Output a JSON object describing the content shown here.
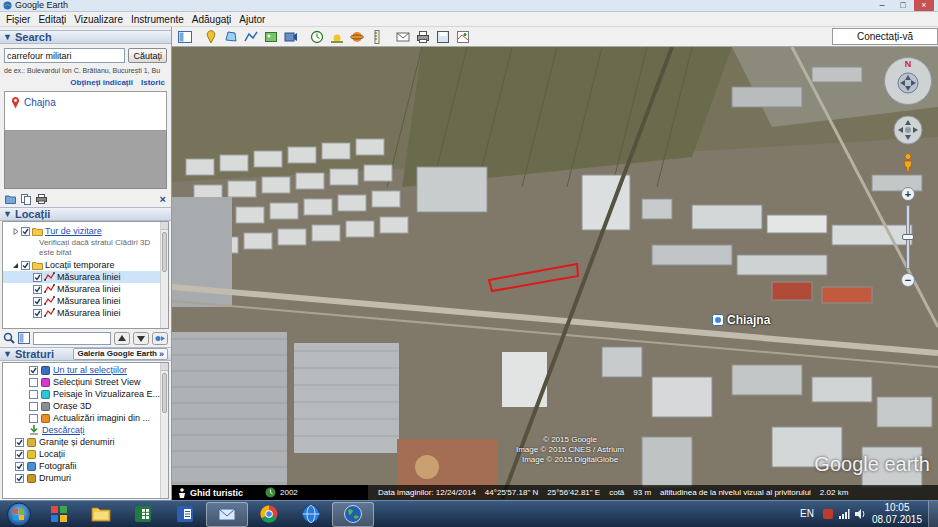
{
  "window": {
    "title": "Google Earth",
    "controls": [
      "–",
      "□",
      "×"
    ]
  },
  "menu": [
    "Fișier",
    "Editați",
    "Vizualizare",
    "Instrumente",
    "Adăugați",
    "Ajutor"
  ],
  "search": {
    "arrow": "▼",
    "header": "Search",
    "query": "carrefour militari",
    "button": "Căutați",
    "hint": "de ex.: Bulevardul Ion C. Brătianu, București 1, Bu",
    "links": [
      "Obțineți indicații",
      "Istoric"
    ],
    "results": [
      {
        "label": "Chajna",
        "selected": false
      }
    ]
  },
  "places": {
    "arrow": "▼",
    "header": "Locații",
    "close": "×",
    "items": [
      {
        "label": "Tur de vizitare",
        "kind": "folder",
        "checked": true,
        "expanded": false,
        "link": true,
        "selected": false,
        "note": "Verificați dacă stratul Clădiri 3D este bifat"
      },
      {
        "label": "Locații temporare",
        "kind": "folder",
        "checked": true,
        "expanded": true,
        "link": false,
        "selected": false,
        "children": [
          {
            "label": "Măsurarea liniei",
            "kind": "path",
            "checked": true,
            "link": false,
            "selected": true
          },
          {
            "label": "Măsurarea liniei",
            "kind": "path",
            "checked": true,
            "link": false,
            "selected": false
          },
          {
            "label": "Măsurarea liniei",
            "kind": "path",
            "checked": true,
            "link": false,
            "selected": false
          },
          {
            "label": "Măsurarea liniei",
            "kind": "path",
            "checked": true,
            "link": false,
            "selected": false
          }
        ]
      }
    ]
  },
  "layers": {
    "arrow": "▼",
    "header": "Straturi",
    "gallery": "Galeria Google Earth",
    "gallery_arrow": "»",
    "items": [
      {
        "label": "Un tur al selecțiilor",
        "kind": "sublayer",
        "checked": true,
        "link": true,
        "color": "#3a6fc4"
      },
      {
        "label": "Selecțiuni Street View",
        "kind": "sublayer",
        "checked": false,
        "link": false,
        "color": "#d23ad0"
      },
      {
        "label": "Peisaje în Vizualizarea E...",
        "kind": "sublayer",
        "checked": false,
        "link": false,
        "color": "#29c6d8"
      },
      {
        "label": "Orașe 3D",
        "kind": "sublayer",
        "checked": false,
        "link": false,
        "color": "#8a8f96"
      },
      {
        "label": "Actualizări imagini din ...",
        "kind": "sublayer",
        "checked": false,
        "link": false,
        "color": "#f08a24"
      },
      {
        "label": "Descărcați",
        "kind": "download",
        "checked": false,
        "link": true,
        "color": "#3b8c3b"
      },
      {
        "label": "Granițe și denumiri",
        "kind": "layer",
        "checked": true,
        "link": false,
        "color": "#d9b23a"
      },
      {
        "label": "Locații",
        "kind": "layer",
        "checked": true,
        "link": false,
        "color": "#e3c42a"
      },
      {
        "label": "Fotografii",
        "kind": "layer",
        "checked": true,
        "link": false,
        "color": "#4a8fd0"
      },
      {
        "label": "Drumuri",
        "kind": "layer",
        "checked": true,
        "link": false,
        "color": "#c9962a"
      }
    ]
  },
  "toolbar": {
    "connect": "Conectați-vă"
  },
  "map": {
    "place": "Chiajna",
    "copyright": [
      "© 2015 Google",
      "Image © 2015 CNES / Astrium",
      "Image © 2015 DigitalGlobe"
    ],
    "logo": "Google earth",
    "compass": "N",
    "zoom": {
      "plus": "+",
      "minus": "−",
      "level": 0.5
    },
    "tour": "Ghid turistic",
    "history": "2002",
    "status": [
      "Data imaginilor: 12/24/2014",
      "44°25'57.18\" N",
      "25°56'42.81\" E",
      "cotă",
      "93 m",
      "altitudinea de la nivelul vizual al privitorului",
      "2.02 km"
    ]
  },
  "taskbar": {
    "lang": "EN",
    "time": "10:05",
    "date": "08.07.2015",
    "apps": [
      {
        "kind": "grid",
        "active": false
      },
      {
        "kind": "folder",
        "active": false
      },
      {
        "kind": "excel",
        "active": false
      },
      {
        "kind": "word",
        "active": false
      },
      {
        "kind": "mail",
        "active": true
      },
      {
        "kind": "chrome",
        "active": false
      },
      {
        "kind": "globe",
        "active": false
      },
      {
        "kind": "earth",
        "active": true
      }
    ]
  }
}
